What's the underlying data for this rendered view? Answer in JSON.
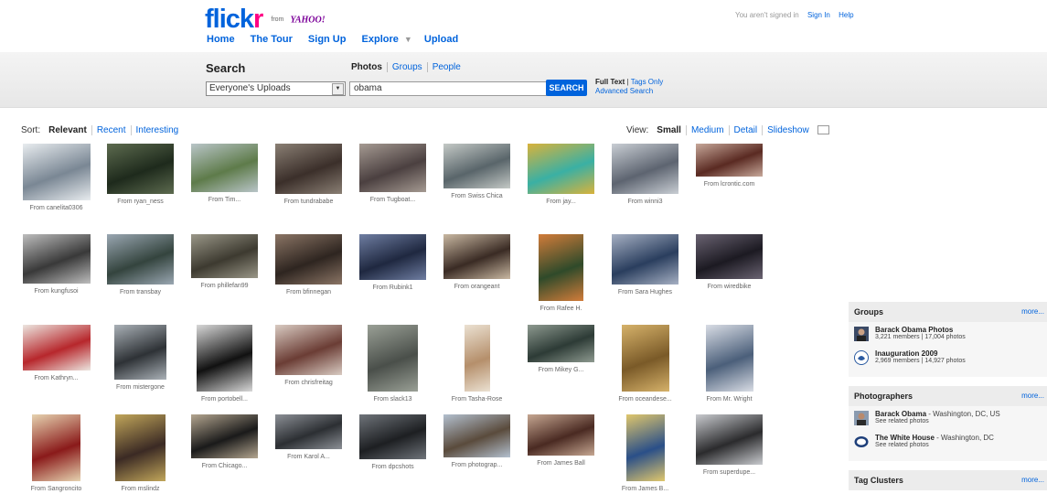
{
  "header": {
    "logo_word": "flick",
    "logo_r": "r",
    "logo_from": "from",
    "logo_yahoo": "YAHOO!",
    "nav": [
      "Home",
      "The Tour",
      "Sign Up",
      "Explore",
      "Upload"
    ],
    "signin_status": "You aren't signed in",
    "signin_link": "Sign In",
    "help_link": "Help"
  },
  "search": {
    "title": "Search",
    "tabs": [
      "Photos",
      "Groups",
      "People"
    ],
    "scope_value": "Everyone's Uploads",
    "query_value": "obama",
    "button_label": "SEARCH",
    "full_text": "Full Text",
    "tags_only": "Tags Only",
    "advanced": "Advanced Search"
  },
  "sort": {
    "label": "Sort:",
    "options": [
      "Relevant",
      "Recent",
      "Interesting"
    ],
    "selected": "Relevant"
  },
  "view": {
    "label": "View:",
    "options": [
      "Small",
      "Medium",
      "Detail",
      "Slideshow"
    ],
    "selected": "Small"
  },
  "photos": [
    {
      "cap": "From canelita0306",
      "c1": "#7a8794",
      "c2": "#e8ecef"
    },
    {
      "cap": "From ryan_ness",
      "c1": "#1e2a1c",
      "c2": "#5d6b4f"
    },
    {
      "cap": "From Tim...",
      "c1": "#5e7b4a",
      "c2": "#b9c5c8"
    },
    {
      "cap": "From tundrababe",
      "c1": "#3b2f2a",
      "c2": "#8a7f74"
    },
    {
      "cap": "From Tugboat...",
      "c1": "#4b4040",
      "c2": "#a59a92"
    },
    {
      "cap": "From Swiss Chica",
      "c1": "#59656a",
      "c2": "#c4c9c6"
    },
    {
      "cap": "From jay...",
      "c1": "#3ab0a4",
      "c2": "#d9b23b"
    },
    {
      "cap": "From winni3",
      "c1": "#5d6470",
      "c2": "#c9ced4"
    },
    {
      "cap": "From lcrontic.com",
      "c1": "#5a2a22",
      "c2": "#c7a89a"
    },
    {
      "cap": "From kungfusoi",
      "c1": "#393939",
      "c2": "#bdbdbd"
    },
    {
      "cap": "From transbay",
      "c1": "#34443e",
      "c2": "#9aa7b2"
    },
    {
      "cap": "From phillefan99",
      "c1": "#3d3a30",
      "c2": "#9a9788"
    },
    {
      "cap": "From bfinnegan",
      "c1": "#2e2520",
      "c2": "#8b7565"
    },
    {
      "cap": "From Rubink1",
      "c1": "#1f2840",
      "c2": "#6f7ea2"
    },
    {
      "cap": "From orangeant",
      "c1": "#3a2b24",
      "c2": "#c9b8a2"
    },
    {
      "cap": "From Rafee H.",
      "c1": "#2f4a2a",
      "c2": "#d27c3a"
    },
    {
      "cap": "From Sara Hughes",
      "c1": "#2a3e5e",
      "c2": "#a6b0c3"
    },
    {
      "cap": "From wiredbike",
      "c1": "#1c1a22",
      "c2": "#6a6372"
    },
    {
      "cap": "From Kathryn...",
      "c1": "#b7272c",
      "c2": "#ece6e0"
    },
    {
      "cap": "From mistergone",
      "c1": "#2e3236",
      "c2": "#aab1b7"
    },
    {
      "cap": "From portobell...",
      "c1": "#111111",
      "c2": "#d8d8d8"
    },
    {
      "cap": "From chrisfreitag",
      "c1": "#6b3d35",
      "c2": "#d9cbc2"
    },
    {
      "cap": "From slack13",
      "c1": "#4a4f4a",
      "c2": "#9aa096"
    },
    {
      "cap": "From Tasha-Rose",
      "c1": "#b58f6b",
      "c2": "#ebe1d2"
    },
    {
      "cap": "From Mikey G...",
      "c1": "#2d3b36",
      "c2": "#8e9a90"
    },
    {
      "cap": "From oceandese...",
      "c1": "#7a5a28",
      "c2": "#d6b26a"
    },
    {
      "cap": "From Mr. Wright",
      "c1": "#4b5f7a",
      "c2": "#d9dde5"
    },
    {
      "cap": "From Sangroncito",
      "c1": "#8a1a1a",
      "c2": "#e6d3b0"
    },
    {
      "cap": "From mslindz",
      "c1": "#3b2a24",
      "c2": "#c1a65a"
    },
    {
      "cap": "From Chicago...",
      "c1": "#1a1a1a",
      "c2": "#b4a690"
    },
    {
      "cap": "From Karol A...",
      "c1": "#2c2f33",
      "c2": "#8c9096"
    },
    {
      "cap": "From dpcshots",
      "c1": "#1d1f22",
      "c2": "#6f747a"
    },
    {
      "cap": "From photograp...",
      "c1": "#5a4b3c",
      "c2": "#b3c0cf"
    },
    {
      "cap": "From James Ball",
      "c1": "#4a2a22",
      "c2": "#c6a792"
    },
    {
      "cap": "From James B...",
      "c1": "#2a4f88",
      "c2": "#e0c76c"
    },
    {
      "cap": "From superdupe...",
      "c1": "#2b2b2d",
      "c2": "#c9cbcf"
    }
  ],
  "sidebar": {
    "more": "more...",
    "groups": {
      "title": "Groups",
      "items": [
        {
          "name": "Barack Obama Photos",
          "sub": "3,221 members | 17,004 photos"
        },
        {
          "name": "Inauguration 2009",
          "sub": "2,969 members | 14,927 photos"
        }
      ]
    },
    "photographers": {
      "title": "Photographers",
      "items": [
        {
          "name": "Barack Obama",
          "loc": " - Washington, DC, US",
          "sub": "See related photos"
        },
        {
          "name": "The White House",
          "loc": " - Washington, DC",
          "sub": "See related photos"
        }
      ]
    },
    "tag_clusters": {
      "title": "Tag Clusters"
    }
  }
}
